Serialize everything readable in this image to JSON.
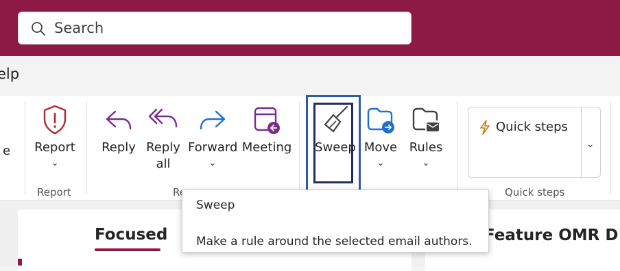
{
  "search": {
    "placeholder": "Search"
  },
  "menubar": {
    "help_partial": "elp"
  },
  "ribbon": {
    "partial_left": "e",
    "report": {
      "label": "Report",
      "group": "Report"
    },
    "respond": {
      "reply": "Reply",
      "reply_all_line1": "Reply",
      "reply_all_line2": "all",
      "forward": "Forward",
      "meeting": "Meeting",
      "group_partial": "Re"
    },
    "sweep": {
      "label": "Sweep"
    },
    "move": {
      "label": "Move"
    },
    "rules": {
      "label": "Rules"
    },
    "quick_steps": {
      "label": "Quick steps",
      "group": "Quick steps"
    },
    "chevron": "⌄"
  },
  "tooltip": {
    "title": "Sweep",
    "description": "Make a rule around the selected email authors."
  },
  "mail": {
    "focused_tab": "Focused",
    "subject_partial": "Feature OMR D"
  },
  "colors": {
    "brand": "#8c1a44",
    "accent_blue": "#0f6cbd",
    "highlight": "#2f5aa8"
  }
}
